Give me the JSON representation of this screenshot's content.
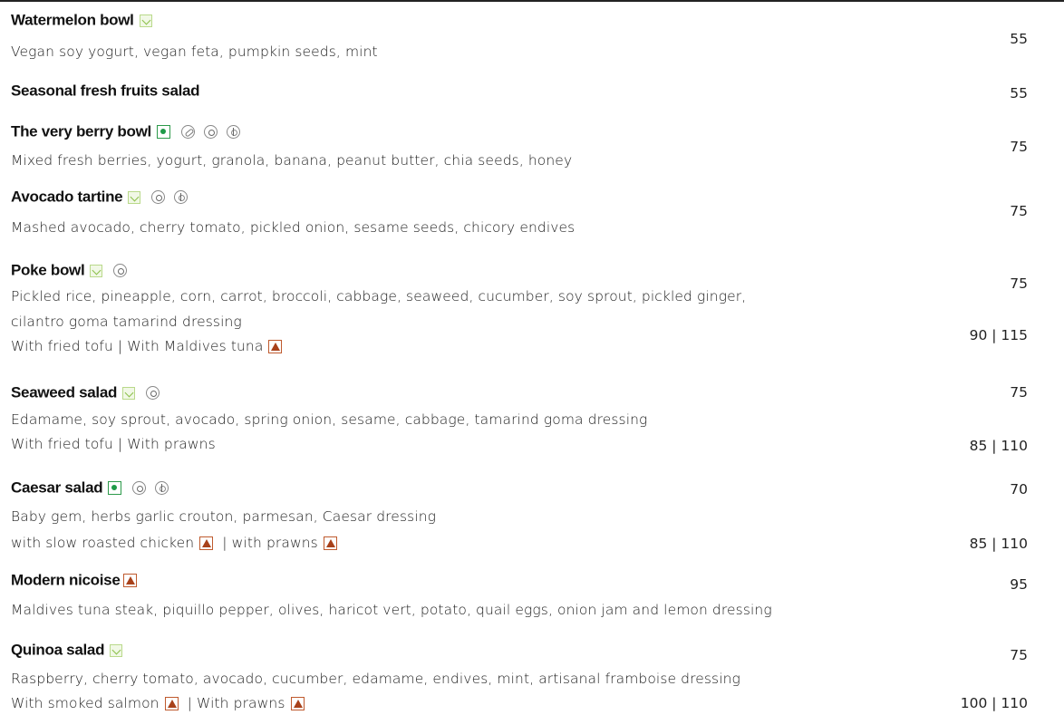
{
  "items": [
    {
      "name": "Watermelon bowl",
      "desc": "Vegan soy yogurt, vegan feta, pumpkin seeds, mint",
      "price": "55"
    },
    {
      "name": "Seasonal fresh fruits salad",
      "price": "55"
    },
    {
      "name": "The very berry bowl",
      "desc": "Mixed fresh berries, yogurt, granola, banana, peanut butter, chia seeds, honey",
      "price": "75"
    },
    {
      "name": "Avocado tartine",
      "desc": "Mashed avocado, cherry tomato, pickled onion, sesame seeds, chicory endives",
      "price": "75"
    },
    {
      "name": "Poke bowl",
      "desc": "Pickled rice, pineapple, corn, carrot, broccoli, cabbage, seaweed, cucumber,  soy sprout, pickled ginger,",
      "desc2": "cilantro goma tamarind dressing",
      "option": "With fried tofu  |  With Maldives tuna",
      "price": "75",
      "option_price": "90 | 115"
    },
    {
      "name": "Seaweed salad",
      "desc": "Edamame, soy sprout, avocado, spring onion, sesame, cabbage,  tamarind goma dressing",
      "option": "With fried tofu  |  With prawns",
      "price": "75",
      "option_price": "85 | 110"
    },
    {
      "name": "Caesar salad",
      "desc": "Baby gem, herbs garlic crouton, parmesan, Caesar dressing",
      "option_a": "with slow roasted chicken",
      "option_b": "|  with prawns",
      "price": "70",
      "option_price": "85 | 110"
    },
    {
      "name": "Modern nicoise",
      "desc": "Maldives tuna steak, piquillo pepper, olives, haricot vert, potato, quail eggs, onion jam and lemon dressing",
      "price": "95"
    },
    {
      "name": "Quinoa salad",
      "desc": "Raspberry, cherry tomato, avocado, cucumber, edamame, endives, mint, artisanal framboise dressing",
      "option_a": "With smoked salmon",
      "option_b": "|  With prawns",
      "price": "75",
      "option_price": "100 | 110"
    }
  ],
  "icons": {
    "vegan": "vegan-icon",
    "vegetarian": "vegetarian-icon",
    "nuts": "nuts-icon",
    "spiral": "spiral-icon",
    "grain": "gluten-icon",
    "sustainable": "sustainable-seafood-icon"
  },
  "colors": {
    "vegan": "#8cc04a",
    "vegetarian": "#1f9a48",
    "sustainable": "#a8411a"
  }
}
